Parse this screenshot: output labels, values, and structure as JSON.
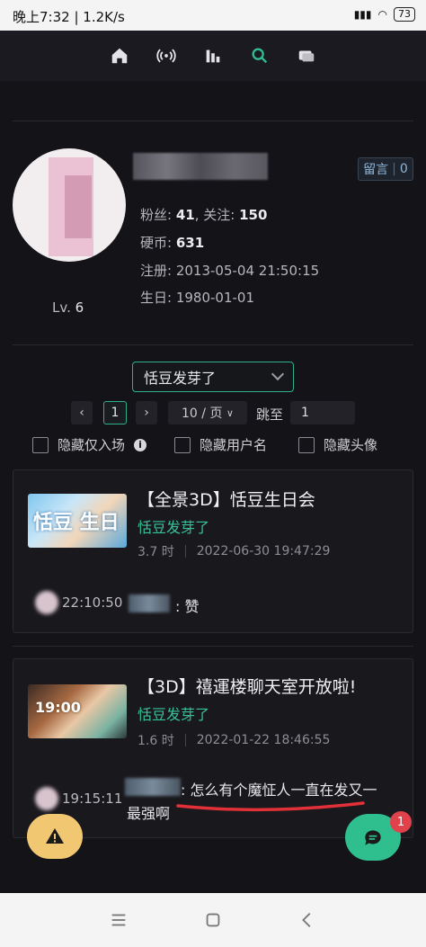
{
  "status_bar": {
    "time_speed": "晚上7:32 | 1.2K/s",
    "battery": "73"
  },
  "nav": {
    "icons": [
      "home-icon",
      "live-icon",
      "ranking-icon",
      "search-icon",
      "messages-icon"
    ],
    "active": "search-icon",
    "accent": "#2fbf8f"
  },
  "profile": {
    "level_prefix": "Lv.",
    "level": "6",
    "message_button": {
      "label": "留言",
      "count": "0"
    },
    "fans_label": "粉丝:",
    "fans": "41",
    "follow_label": ", 关注:",
    "follow": "150",
    "coins_label": "硬币:",
    "coins": "631",
    "register_label": "注册:",
    "register": "2013-05-04 21:50:15",
    "birthday_label": "生日:",
    "birthday": "1980-01-01"
  },
  "filter": {
    "selected": "恬豆发芽了",
    "page_current": "1",
    "per_page": "10 / 页",
    "goto_label": "跳至",
    "goto_value": "1",
    "checkboxes": [
      "隐藏仅入场",
      "隐藏用户名",
      "隐藏头像"
    ]
  },
  "cards": [
    {
      "thumb_text": "恬豆  生日",
      "title": "【全景3D】恬豆生日会",
      "author": "恬豆发芽了",
      "duration": "3.7 时",
      "date": "2022-06-30 19:47:29",
      "comment_time": "22:10:50",
      "comment_text": ": 赞"
    },
    {
      "thumb_text": "19:00",
      "title": "【3D】禧運楼聊天室开放啦!",
      "author": "恬豆发芽了",
      "duration": "1.6 时",
      "date": "2022-01-22 18:46:55",
      "comment_time": "19:15:11",
      "comment_text": ": 怎么有个魔怔人一直在发又一",
      "comment_text_2": "最强啊"
    }
  ],
  "fab": {
    "badge": "1"
  }
}
